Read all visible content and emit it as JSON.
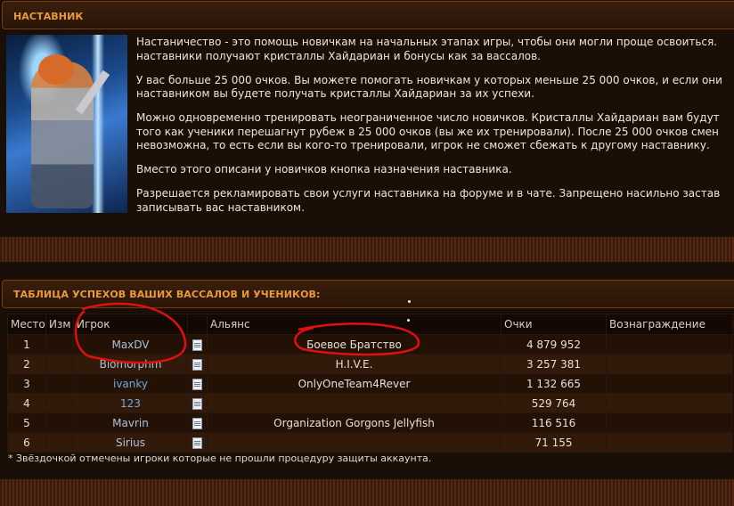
{
  "mentor": {
    "header": "НАСТАВНИК",
    "paragraphs": [
      "Настаничество - это помощь новичкам на начальных этапах игры, чтобы они могли проще освоиться.\nнаставники получают кристаллы Хайдариан и бонусы как за вассалов.",
      "У вас больше 25 000 очков. Вы можете помогать новичкам у которых меньше 25 000 очков, и если они\nнаставником вы будете получать кристаллы Хайдариан за их успехи.",
      "Можно одновременно тренировать неограниченное число новичков. Кристаллы Хайдариан вам будут\nтого как ученики перешагнут рубеж в 25 000 очков (вы же их тренировали). После 25 000 очков смен\nневозможна, то есть если вы кого-то тренировали, игрок не сможет сбежать к другому наставнику.",
      "Вместо этого описани у новичков кнопка назначения наставника.",
      "Разрешается рекламировать свои услуги наставника на форуме и в чате. Запрещено насильно застав\nзаписывать вас наставником."
    ]
  },
  "results": {
    "header": "ТАБЛИЦА УСПЕХОВ ВАШИХ ВАССАЛОВ И УЧЕНИКОВ:",
    "columns": {
      "place": "Место",
      "change": "Изм",
      "player": "Игрок",
      "alliance": "Альянс",
      "points": "Очки",
      "reward": "Вознаграждение"
    },
    "rows": [
      {
        "place": "1",
        "change": "",
        "player": "MaxDV",
        "alliance": "Боевое Братство",
        "points": "4 879 952",
        "reward": ""
      },
      {
        "place": "2",
        "change": "",
        "player": "Biomorphm",
        "alliance": "H.I.V.E.",
        "points": "3 257 381",
        "reward": ""
      },
      {
        "place": "3",
        "change": "",
        "player": "ivanky",
        "alliance": "OnlyOneTeam4Rever",
        "points": "1 132 665",
        "reward": ""
      },
      {
        "place": "4",
        "change": "",
        "player": "123",
        "alliance": "",
        "points": "529 764",
        "reward": ""
      },
      {
        "place": "5",
        "change": "",
        "player": "Mavrin",
        "alliance": "Organization Gorgons Jellyfish",
        "points": "116 516",
        "reward": ""
      },
      {
        "place": "6",
        "change": "",
        "player": "Sirius",
        "alliance": "",
        "points": "71 155",
        "reward": ""
      }
    ],
    "footnote": "* Звёздочкой отмечены игроки которые не прошли процедуру защиты аккаунта."
  },
  "colors": {
    "accent_header": "#e89a3c",
    "annotation_red": "#e01010",
    "link_blue": "#6fa9d6"
  }
}
